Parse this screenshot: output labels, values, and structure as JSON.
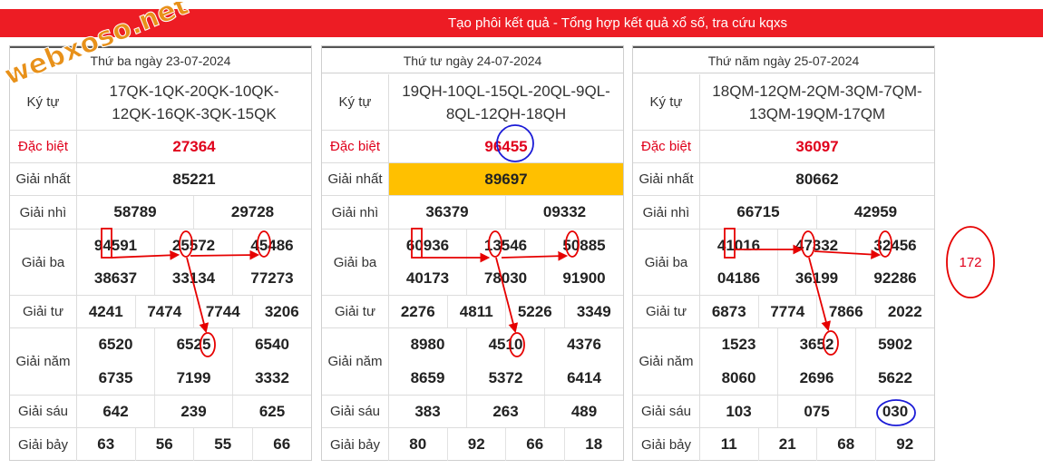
{
  "header": {
    "title": "Tạo phôi kết quả - Tổng hợp kết quả xổ số, tra cứu kqxs"
  },
  "watermark": {
    "text": "webxoso.net"
  },
  "labels": {
    "kytu": "Ký tự",
    "db": "Đặc biệt",
    "g1": "Giải nhất",
    "g2": "Giải nhì",
    "g3": "Giải ba",
    "g4": "Giải tư",
    "g5": "Giải năm",
    "g6": "Giải sáu",
    "g7": "Giải bảy"
  },
  "panels": [
    {
      "date": "Thứ ba ngày 23-07-2024",
      "kytu": [
        "17QK-1QK-20QK-10QK-",
        "12QK-16QK-3QK-15QK"
      ],
      "db": "27364",
      "g1": "85221",
      "g2": [
        "58789",
        "29728"
      ],
      "g3": [
        "94591",
        "25572",
        "45486",
        "38637",
        "33134",
        "77273"
      ],
      "g4": [
        "4241",
        "7474",
        "7744",
        "3206"
      ],
      "g5": [
        "6520",
        "6525",
        "6540",
        "6735",
        "7199",
        "3332"
      ],
      "g6": [
        "642",
        "239",
        "625"
      ],
      "g7": [
        "63",
        "56",
        "55",
        "66"
      ]
    },
    {
      "date": "Thứ tư ngày 24-07-2024",
      "kytu": [
        "19QH-10QL-15QL-20QL-9QL-",
        "8QL-12QH-18QH"
      ],
      "db": "96455",
      "g1": "89697",
      "g2": [
        "36379",
        "09332"
      ],
      "g3": [
        "60936",
        "13546",
        "50885",
        "40173",
        "78030",
        "91900"
      ],
      "g4": [
        "2276",
        "4811",
        "5226",
        "3349"
      ],
      "g5": [
        "8980",
        "4510",
        "4376",
        "8659",
        "5372",
        "6414"
      ],
      "g6": [
        "383",
        "263",
        "489"
      ],
      "g7": [
        "80",
        "92",
        "66",
        "18"
      ]
    },
    {
      "date": "Thứ năm ngày 25-07-2024",
      "kytu": [
        "18QM-12QM-2QM-3QM-7QM-",
        "13QM-19QM-17QM"
      ],
      "db": "36097",
      "g1": "80662",
      "g2": [
        "66715",
        "42959"
      ],
      "g3": [
        "41016",
        "47332",
        "32456",
        "04186",
        "36199",
        "92286"
      ],
      "g4": [
        "6873",
        "7774",
        "7866",
        "2022"
      ],
      "g5": [
        "1523",
        "3652",
        "5902",
        "8060",
        "2696",
        "5622"
      ],
      "g6": [
        "103",
        "075",
        "030"
      ],
      "g7": [
        "11",
        "21",
        "68",
        "92"
      ]
    }
  ],
  "side_note": "172",
  "colors": {
    "accent": "#ed1c24",
    "highlight": "#ffc000",
    "annotation_red": "#e60000",
    "annotation_blue": "#1a1ad6",
    "watermark": "#e8911a"
  }
}
